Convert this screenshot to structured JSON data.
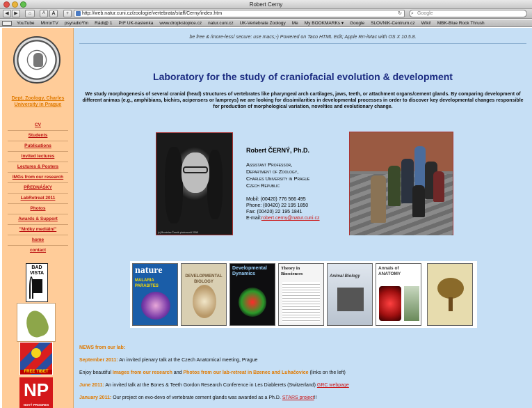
{
  "window": {
    "title": "Robert Cerny"
  },
  "toolbar": {
    "url": "http://web.natur.cuni.cz/zoologie/vertebrata/staff/Cerny/index.htm",
    "search_placeholder": "Google",
    "back": "◀",
    "forward": "▶",
    "home": "⌂",
    "text_smaller": "A",
    "text_bigger": "A",
    "add_bookmark": "+",
    "reload": "↻"
  },
  "bookmarks": [
    "YouTube",
    "MirrorTV",
    "psyradio*fm",
    "Rádi@ 1",
    "PrF UK-nastenka",
    "www.dropkstopice.cz",
    "natur.cuni.cz",
    "UK-Vertebrate Zoology",
    "Me",
    "My BOOKMARKs ▾",
    "Google",
    "SLOVNIK-Centrum.cz",
    "Wiki!",
    "MBK-Blue Rock Thrush"
  ],
  "sidebar": {
    "dept": "Dept. Zoology, Charles University in Prague",
    "nav": [
      "CV",
      "Students",
      "Publications",
      "Invited lectures",
      "Lectures & Posters",
      "IMGs from our research",
      "PŘEDNÁŠKY",
      "LabRetreat 2011",
      "Photos",
      "Awards & Support",
      "\"Mrdky mediální\"",
      "home",
      "contact"
    ],
    "vista_badge": "BAD VISTA",
    "tibet_badge": "FREE TIBET",
    "np_badge": "NP",
    "np_sub": "NOVÝ PROGRES"
  },
  "main": {
    "freedom_line": "be free & /more-less/ secure: use macs;-) Powered on Taco HTML Edit; Apple Rrr-iMac with OS X 10.5.8.",
    "title": "Laboratory for the study of craniofacial evolution & development",
    "intro": "We study morphogenesis of several cranial (head) structures of vertebrates like pharyngeal arch cartilages, jaws, teeth, or attachment organs/cement glands. By comparing development of different animas (e.g., amphibians, bichirs, acipensers or lampreys) we are looking for dissimilarities in developmental processes in order to discover key developmental changes responsible for production of morphological variation, novelties and evolutionary change.",
    "person": {
      "name": "Robert ČERNÝ, Ph.D.",
      "role_1": "Assistant Professor,",
      "role_2": "Department of Zoology,",
      "role_3": "Charles University in Prague",
      "role_4": "Czech Republic",
      "mobil": "Mobil: (00420) 776 566 495",
      "phone": "Phone: (00420) 22 195 1850",
      "fax": "Fax: (00420) 22 195 1841",
      "email_label": "E-mail:",
      "email": "robert.cerny@natur.cuni.cz"
    },
    "portrait_credit": "(c) Bronislav Černík photoworld 2008",
    "journals": [
      {
        "title": "nature",
        "sub": "MALARIA PARASITES"
      },
      {
        "title": "DEVELOPMENTAL BIOLOGY",
        "sub": ""
      },
      {
        "title": "Developmental Dynamics",
        "sub": ""
      },
      {
        "title": "Theory in Biosciences",
        "sub": ""
      },
      {
        "title": "Animal Biology",
        "sub": ""
      },
      {
        "title": "Annals of ANATOMY",
        "sub": ""
      },
      {
        "title": "",
        "sub": ""
      }
    ],
    "news_head": "NEWS from our lab:",
    "news": {
      "n1_date": "September 2011:",
      "n1_text": " An invited plenary talk at the Czech Anatomical meeting, Prague",
      "n2_pre": "Enjoy beautiful ",
      "n2_hl1": "Images from our research",
      "n2_mid": " and ",
      "n2_hl2": "Photos from our lab-retreat in Bzenec and Luhačovice",
      "n2_post": " (links on the left)",
      "n3_date": "June 2011:",
      "n3_text": " An invited talk at the Bones & Teeth Gordon Research Conference in Les Diablerets (Switzerland) ",
      "n3_link": "GRC webpage",
      "n4_date": "January 2011:",
      "n4_text": " Our project on evo-devo of vertebrate cement glands was awarded as a Ph.D. ",
      "n4_link": "STARS project",
      "n4_post": "!!"
    }
  }
}
